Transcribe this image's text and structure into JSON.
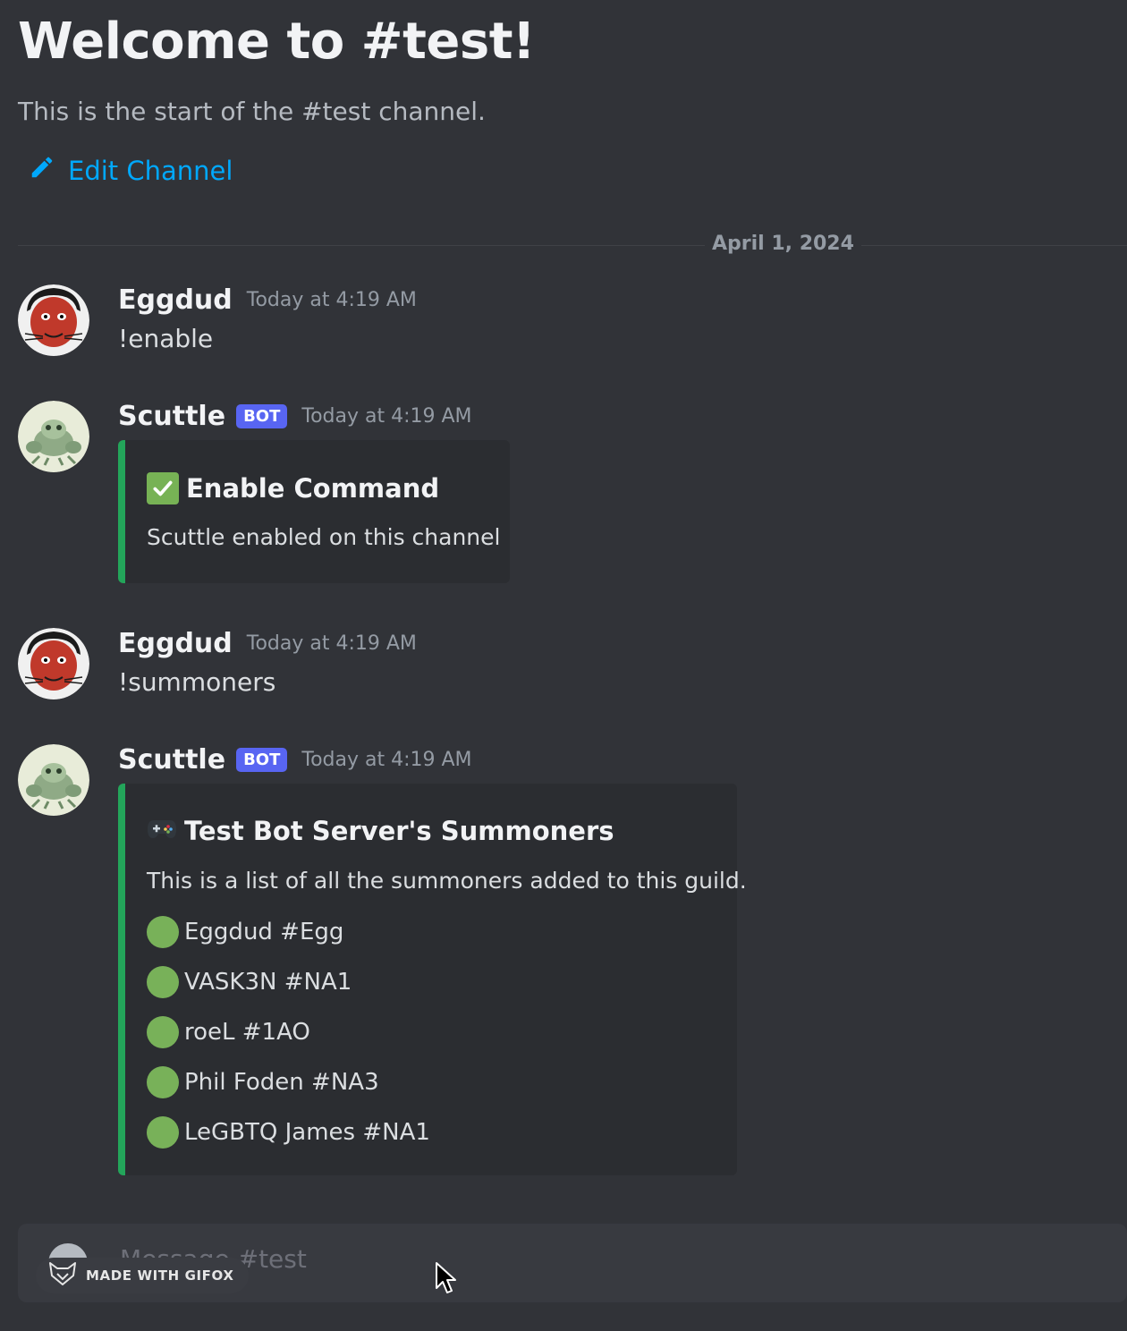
{
  "channel": {
    "welcome_title": "Welcome to #test!",
    "welcome_subtitle": "This is the start of the #test channel.",
    "edit_label": "Edit Channel",
    "date_divider": "April 1, 2024"
  },
  "messages": [
    {
      "author": "Eggdud",
      "timestamp": "Today at 4:19 AM",
      "text": "!enable",
      "avatar_icon": "red-creature-avatar"
    },
    {
      "author": "Scuttle",
      "badge": "BOT",
      "timestamp": "Today at 4:19 AM",
      "avatar_icon": "crab-avatar",
      "embed": {
        "icon": "check-mark-icon",
        "title": "Enable Command",
        "description": "Scuttle enabled on this channel",
        "accent_color": "#23a55a"
      }
    },
    {
      "author": "Eggdud",
      "timestamp": "Today at 4:19 AM",
      "text": "!summoners",
      "avatar_icon": "red-creature-avatar"
    },
    {
      "author": "Scuttle",
      "badge": "BOT",
      "timestamp": "Today at 4:19 AM",
      "avatar_icon": "crab-avatar",
      "embed": {
        "icon": "game-controller-icon",
        "title": "Test Bot Server's Summoners",
        "description": "This is a list of all the summoners added to this guild.",
        "accent_color": "#23a55a",
        "summoners": [
          "Eggdud #Egg",
          "VASK3N #NA1",
          "roeL #1AO",
          "Phil Foden #NA3",
          "LeGBTQ James #NA1"
        ]
      }
    }
  ],
  "composer": {
    "placeholder": "Message #test"
  },
  "watermark": {
    "label": "MADE WITH GIFOX"
  },
  "colors": {
    "background": "#313338",
    "link": "#00a8fc",
    "bot_badge": "#5865f2",
    "status_green": "#78b159"
  }
}
